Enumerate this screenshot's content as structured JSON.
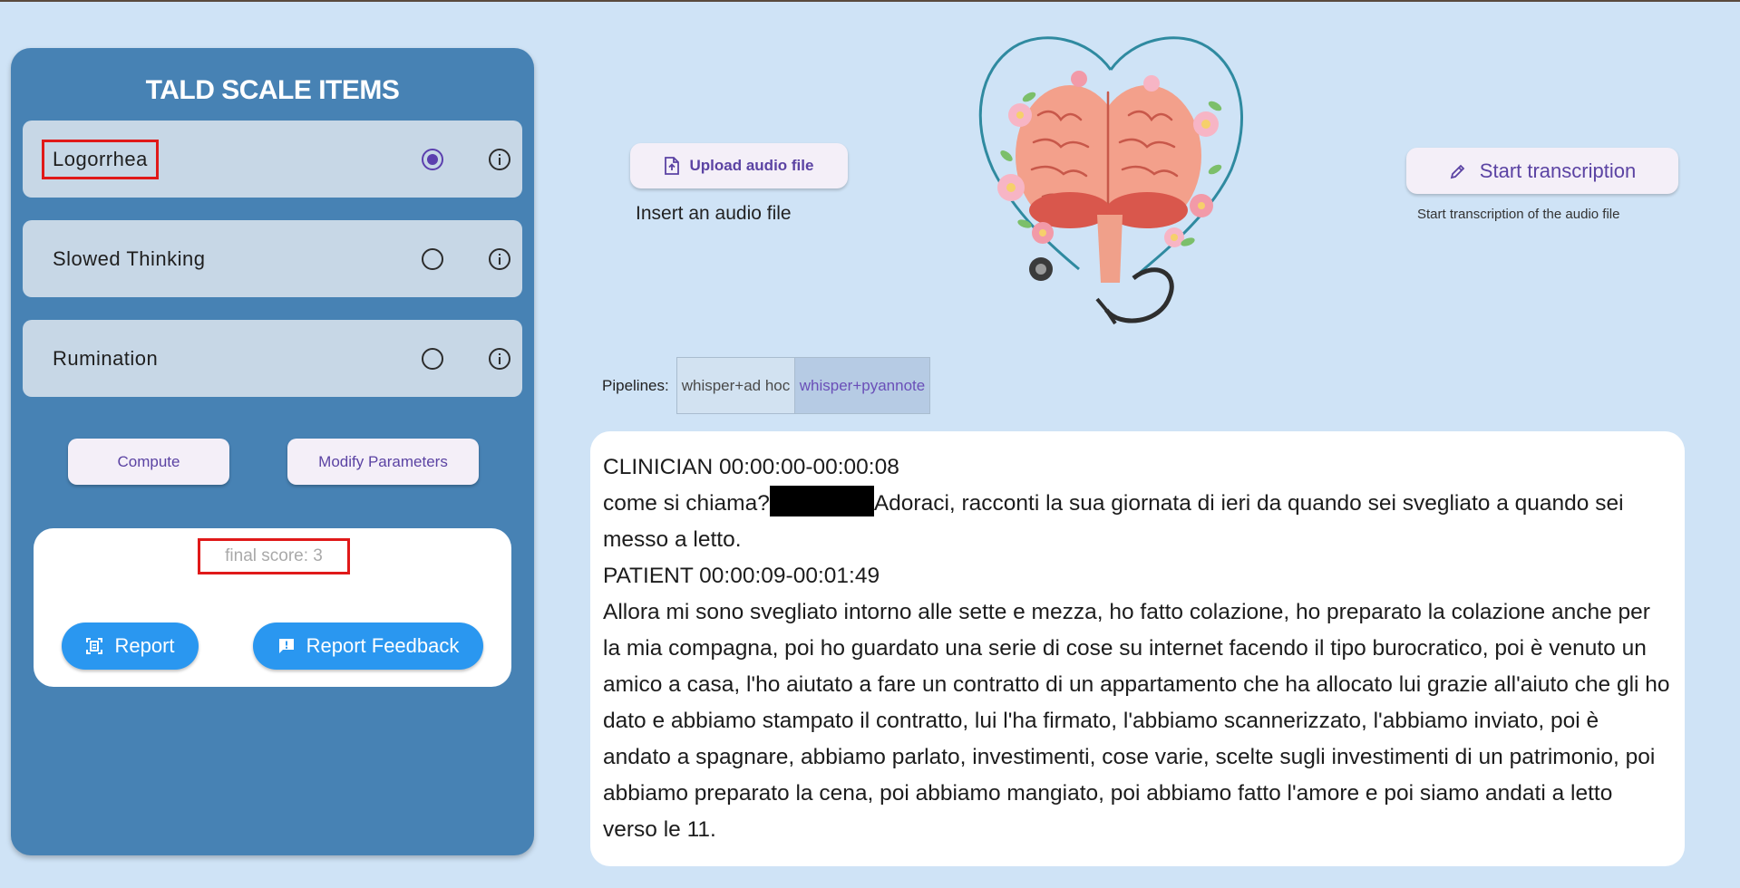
{
  "sidebar": {
    "title": "TALD SCALE ITEMS",
    "items": [
      {
        "label": "Logorrhea",
        "selected": true
      },
      {
        "label": "Slowed Thinking",
        "selected": false
      },
      {
        "label": "Rumination",
        "selected": false
      }
    ],
    "compute_label": "Compute",
    "modify_label": "Modify Parameters",
    "final_score": "final score: 3",
    "report_label": "Report",
    "report_feedback_label": "Report Feedback"
  },
  "upload": {
    "button_label": "Upload audio file",
    "caption": "Insert an audio file"
  },
  "transcription": {
    "button_label": "Start transcription",
    "caption": "Start transcription of the audio file"
  },
  "pipelines": {
    "label": "Pipelines:",
    "options": [
      "whisper+ad hoc",
      "whisper+pyannote"
    ],
    "selected": "whisper+pyannote"
  },
  "transcript": {
    "clinician_header": "CLINICIAN 00:00:00-00:00:08",
    "clinician_before": "come si chiama?",
    "clinician_after": "Adoraci, racconti la sua giornata di ieri da quando sei svegliato a quando sei messo a letto.",
    "patient_header": "PATIENT 00:00:09-00:01:49",
    "patient_text": "Allora mi sono svegliato intorno alle sette e mezza, ho fatto colazione, ho preparato la colazione anche per la mia compagna, poi ho guardato una serie di cose su internet facendo il tipo burocratico, poi è venuto un amico a casa, l'ho aiutato a fare un contratto di un appartamento che ha allocato lui grazie all'aiuto che gli ho dato e abbiamo stampato il contratto, lui l'ha firmato, l'abbiamo scannerizzato, l'abbiamo inviato, poi è andato a spagnare, abbiamo parlato, investimenti, cose varie, scelte sugli investimenti di un patrimonio, poi abbiamo preparato la cena, poi abbiamo mangiato, poi abbiamo fatto l'amore e poi siamo andati a letto verso le 11."
  },
  "colors": {
    "panel": "#4782b4",
    "background": "#cfe3f6",
    "accent_purple": "#5b43a3",
    "report_blue": "#2a97f0",
    "highlight_red": "#e01919"
  }
}
